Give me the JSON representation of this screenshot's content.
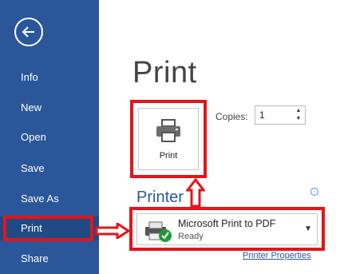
{
  "sidebar": {
    "items": [
      {
        "label": "Info"
      },
      {
        "label": "New"
      },
      {
        "label": "Open"
      },
      {
        "label": "Save"
      },
      {
        "label": "Save As"
      },
      {
        "label": "Print",
        "active": true
      },
      {
        "label": "Share"
      }
    ]
  },
  "main": {
    "title": "Print",
    "print_button_label": "Print",
    "copies_label": "Copies:",
    "copies_value": "1",
    "printer_heading": "Printer",
    "printer_name": "Microsoft Print to PDF",
    "printer_status": "Ready",
    "printer_properties_link": "Printer Properties"
  },
  "colors": {
    "sidebar_bg": "#2b579a",
    "sidebar_active_bg": "#1f4a84",
    "highlight_red": "#e3151a",
    "accent_blue": "#2b579a"
  },
  "icons": [
    "back-arrow-icon",
    "printer-icon",
    "info-icon",
    "printer-ready-icon",
    "dropdown-caret-icon"
  ]
}
